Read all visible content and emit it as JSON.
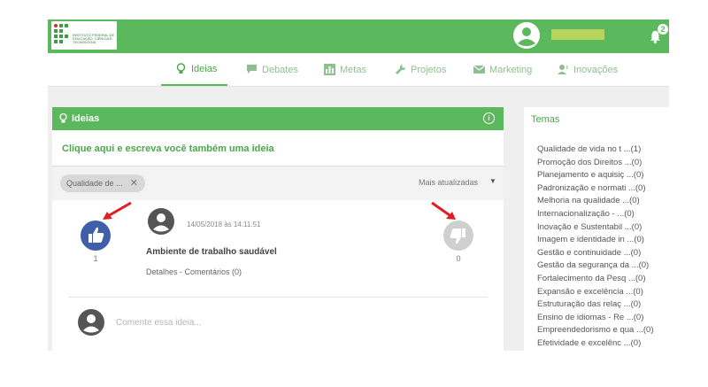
{
  "header": {
    "logo_text": "INSTITUTO FEDERAL DE EDUCAÇÃO, CIÊNCIA E TECNOLOGIA",
    "notification_count": "2"
  },
  "nav": {
    "items": [
      {
        "label": "Ideias",
        "icon": "lightbulb-icon",
        "active": true
      },
      {
        "label": "Debates",
        "icon": "chat-icon",
        "active": false
      },
      {
        "label": "Metas",
        "icon": "bar-chart-icon",
        "active": false
      },
      {
        "label": "Projetos",
        "icon": "wrench-icon",
        "active": false
      },
      {
        "label": "Marketing",
        "icon": "mail-icon",
        "active": false
      },
      {
        "label": "Inovações",
        "icon": "person-voice-icon",
        "active": false
      }
    ]
  },
  "ideas_panel": {
    "title": "Ideias",
    "write_prompt": "Clique aqui e escreva você também uma ideia",
    "filter_chip": "Qualidade de ...",
    "sort_label": "Mais atualizadas",
    "idea": {
      "date": "14/05/2018 às 14:11:51",
      "title": "Ambiente de trabalho saudável",
      "details_label": "Detalhes",
      "separator": " - ",
      "comments_label": "Comentários (0)",
      "upvotes": "1",
      "downvotes": "0"
    },
    "comment_placeholder": "Comente essa ideia..."
  },
  "temas": {
    "title": "Temas",
    "items": [
      "Qualidade de vida no t ...(1)",
      "Promoção dos Direitos ...(0)",
      "Planejamento e aquisiç ...(0)",
      "Padronização e normati ...(0)",
      "Melhoria na qualidade ...(0)",
      "Internacionalização - ...(0)",
      "Inovação e Sustentabil ...(0)",
      "Imagem e identidade in ...(0)",
      "Gestão e continuidade ...(0)",
      "Gestão da segurança da ...(0)",
      "Fortalecimento da Pesq ...(0)",
      "Expansão e excelência ...(0)",
      "Estruturação das relaç ...(0)",
      "Ensino de idiomas - Re ...(0)",
      "Empreendedorismo e qua ...(0)",
      "Efetividade e excelênc ...(0)"
    ]
  },
  "colors": {
    "brand_green": "#5cb85c",
    "upvote_blue": "#3f5fa8",
    "downvote_gray": "#cfcfcf",
    "arrow_red": "#e02020"
  }
}
